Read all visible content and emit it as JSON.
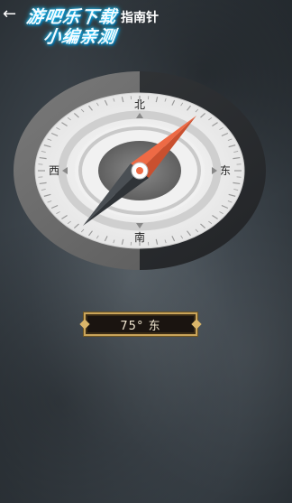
{
  "header": {
    "back_icon": "←",
    "title": "指南针"
  },
  "watermark": {
    "line1": "游吧乐下载",
    "line2": "小编亲测"
  },
  "compass": {
    "north": "北",
    "south": "南",
    "east": "东",
    "west": "西",
    "heading_degrees": 75,
    "colors": {
      "needle_north": "#ee6a45",
      "needle_south": "#3d4246",
      "bezel_light": "#6e6e6e",
      "bezel_dark": "#2b2d30",
      "dial_face": "#f3f3f3"
    }
  },
  "reading": {
    "text": "75° 东"
  }
}
